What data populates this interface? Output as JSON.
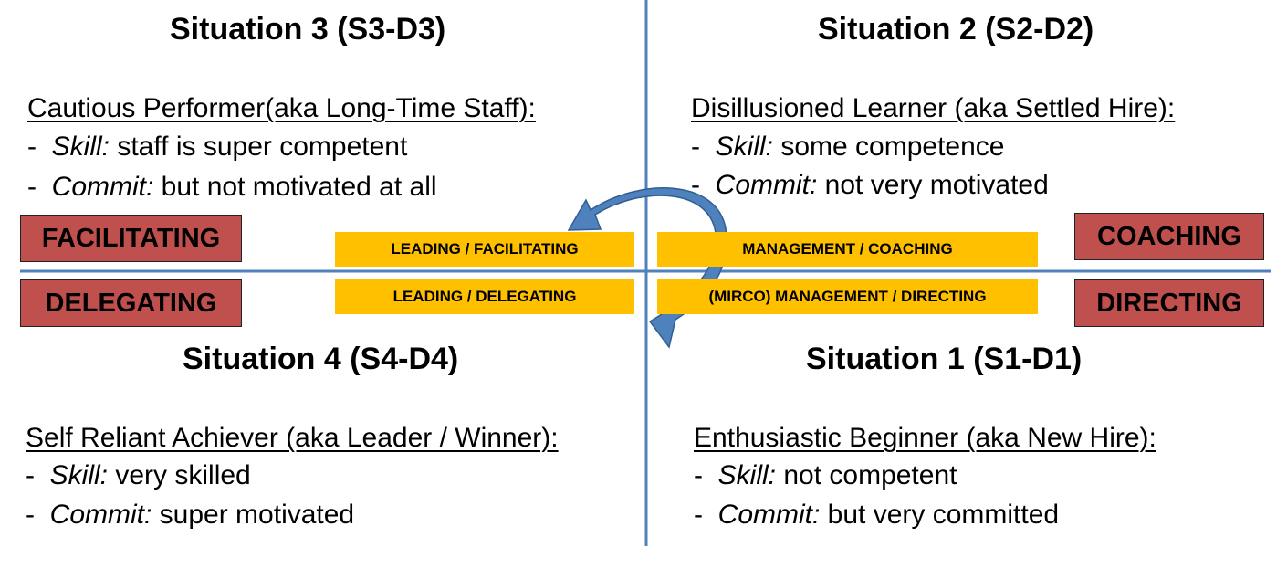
{
  "quadrants": {
    "q3": {
      "title": "Situation 3 (S3-D3)",
      "heading": "Cautious Performer(aka Long-Time Staff):",
      "bullets": [
        {
          "dash": "-",
          "term": "Skill:",
          "text": " staff is super competent"
        },
        {
          "dash": "-",
          "term": "Commit:",
          "text": " but not motivated at all"
        }
      ]
    },
    "q2": {
      "title": "Situation 2 (S2-D2)",
      "heading": "Disillusioned Learner (aka Settled Hire):",
      "bullets": [
        {
          "dash": "-",
          "term": "Skill:",
          "text": " some competence"
        },
        {
          "dash": "-",
          "term": "Commit:",
          "text": " not very motivated"
        }
      ]
    },
    "q4": {
      "title": "Situation 4 (S4-D4)",
      "heading": "Self Reliant Achiever (aka Leader / Winner):",
      "bullets": [
        {
          "dash": "-",
          "term": "Skill:",
          "text": " very skilled"
        },
        {
          "dash": "-",
          "term": "Commit:",
          "text": " super motivated"
        }
      ]
    },
    "q1": {
      "title": "Situation 1 (S1-D1)",
      "heading": "Enthusiastic Beginner (aka New Hire):",
      "bullets": [
        {
          "dash": "-",
          "term": "Skill:",
          "text": " not competent"
        },
        {
          "dash": "-",
          "term": "Commit:",
          "text": " but very committed"
        }
      ]
    }
  },
  "style_boxes": {
    "facilitating": "FACILITATING",
    "delegating": "DELEGATING",
    "coaching": "COACHING",
    "directing": "DIRECTING"
  },
  "bands": {
    "leading_facilitating": "LEADING / FACILITATING",
    "leading_delegating": "LEADING / DELEGATING",
    "management_coaching": "MANAGEMENT / COACHING",
    "micro_management_directing": "(MIRCO) MANAGEMENT / DIRECTING"
  },
  "colors": {
    "axis": "#4f81bd",
    "style_box_fill": "#c0504d",
    "band_fill": "#ffc000",
    "arrow_fill": "#4f81bd",
    "arrow_stroke": "#2f5f92"
  }
}
